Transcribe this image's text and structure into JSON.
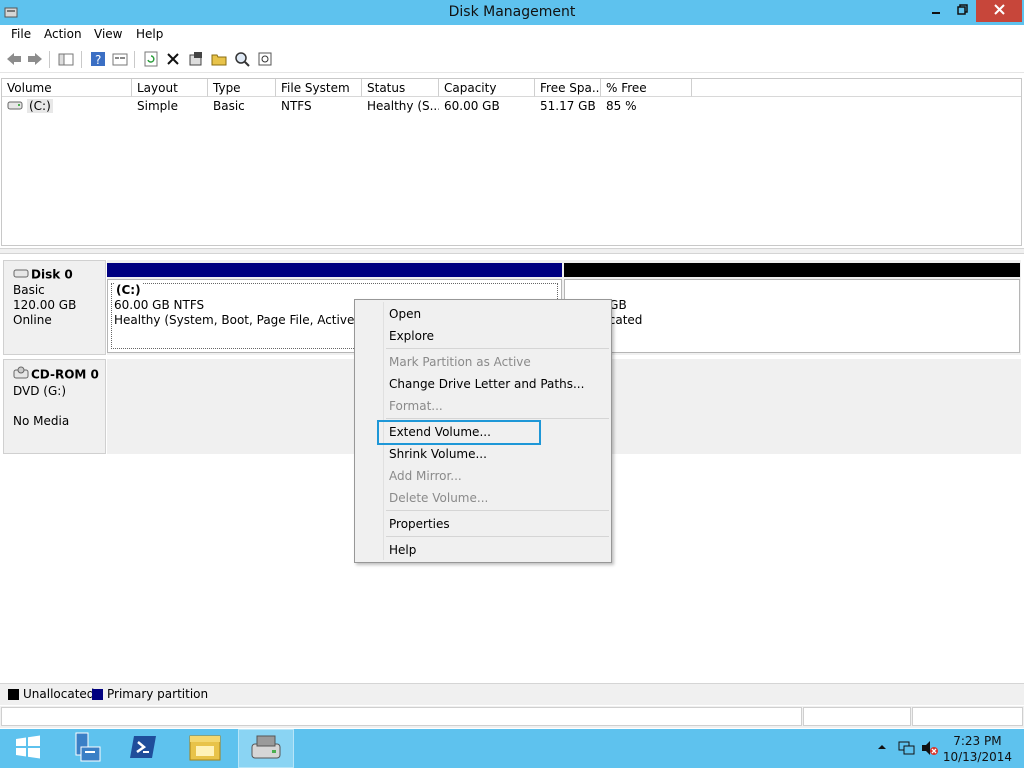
{
  "window": {
    "title": "Disk Management",
    "controls": [
      "minimize-icon",
      "restore-icon",
      "close-icon"
    ]
  },
  "menubar": {
    "items": [
      "File",
      "Action",
      "View",
      "Help"
    ]
  },
  "toolbar": {
    "buttons": [
      "back-icon",
      "forward-icon",
      "console-tree-icon",
      "help-icon",
      "properties-icon",
      "refresh-icon",
      "delete-icon",
      "settings-icon",
      "open-folder-icon",
      "search-icon",
      "rescan-icon"
    ]
  },
  "volume_list": {
    "columns": [
      "Volume",
      "Layout",
      "Type",
      "File System",
      "Status",
      "Capacity",
      "Free Spa...",
      "% Free"
    ],
    "rows": [
      {
        "volume": "(C:)",
        "layout": "Simple",
        "type": "Basic",
        "file_system": "NTFS",
        "status": "Healthy (S...",
        "capacity": "60.00 GB",
        "free_space": "51.17 GB",
        "percent_free": "85 %"
      }
    ]
  },
  "disks": [
    {
      "name": "Disk 0",
      "kind": "Basic",
      "size": "120.00 GB",
      "state": "Online",
      "partitions": [
        {
          "label": "(C:)",
          "size_fs": "60.00 GB NTFS",
          "status": "Healthy (System, Boot, Page File, Active, Crash Dump, Primary Partition)",
          "type": "primary"
        },
        {
          "label": "",
          "size_fs": "60.00 GB",
          "status": "Unallocated",
          "type": "unallocated"
        }
      ]
    },
    {
      "name": "CD-ROM 0",
      "kind": "DVD (G:)",
      "size": "",
      "state": "No Media"
    }
  ],
  "context_menu": {
    "items": [
      {
        "label": "Open",
        "enabled": true
      },
      {
        "label": "Explore",
        "enabled": true
      },
      {
        "label": "Mark Partition as Active",
        "enabled": false
      },
      {
        "label": "Change Drive Letter and Paths...",
        "enabled": true
      },
      {
        "label": "Format...",
        "enabled": false
      },
      {
        "label": "Extend Volume...",
        "enabled": true,
        "highlighted": true
      },
      {
        "label": "Shrink Volume...",
        "enabled": true
      },
      {
        "label": "Add Mirror...",
        "enabled": false
      },
      {
        "label": "Delete Volume...",
        "enabled": false
      },
      {
        "label": "Properties",
        "enabled": true
      },
      {
        "label": "Help",
        "enabled": true
      }
    ]
  },
  "legend": {
    "items": [
      {
        "label": "Unallocated",
        "color": "#000000"
      },
      {
        "label": "Primary partition",
        "color": "#000080"
      }
    ]
  },
  "taskbar": {
    "apps": [
      "start-icon",
      "server-manager-icon",
      "powershell-icon",
      "file-explorer-icon",
      "disk-management-icon"
    ],
    "time": "7:23 PM",
    "date": "10/13/2014"
  },
  "colors": {
    "titlebar": "#5ec2ee",
    "primary_partition": "#000080",
    "unallocated": "#000000",
    "highlight": "#1e97d7"
  }
}
